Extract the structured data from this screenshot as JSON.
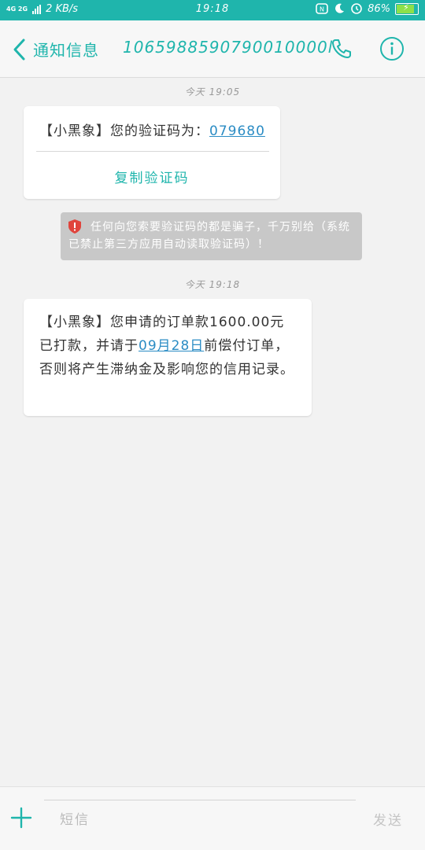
{
  "status_bar": {
    "network": "4G 2G",
    "speed": "2 KB/s",
    "time": "19:18",
    "battery": "86%",
    "battery_level": 0.86
  },
  "header": {
    "title": "通知信息",
    "number": "1065988590790010000l"
  },
  "messages": [
    {
      "timestamp": "今天 19:05",
      "text_prefix": "【小黑象】您的验证码为：",
      "code": "079680",
      "copy_label": "复制验证码"
    },
    {
      "warning": "任何向您索要验证码的都是骗子，千万别给（系统已禁止第三方应用自动读取验证码）！"
    },
    {
      "timestamp": "今天 19:18",
      "text_part1": "【小黑象】您申请的订单款1600.00元已打款，并请于",
      "date_link": "09月28日",
      "text_part2": "前偿付订单，否则将产生滞纳金及影响您的信用记录。"
    }
  ],
  "composer": {
    "placeholder": "短信",
    "send_label": "发送"
  },
  "colors": {
    "accent": "#1fb5ac",
    "link": "#2b8cc4",
    "warning_bg": "#c8c8c8",
    "warning_icon": "#e0443c"
  },
  "icons": [
    "back-arrow-icon",
    "phone-icon",
    "info-icon",
    "shield-warning-icon",
    "plus-icon"
  ]
}
